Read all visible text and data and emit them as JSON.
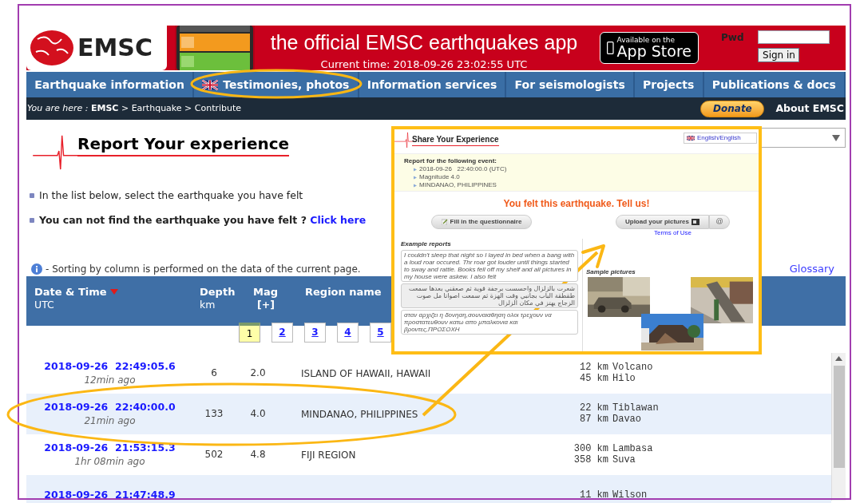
{
  "header": {
    "logo": "EMSC",
    "app_title": "the official EMSC earthquakes app",
    "current_time": "Current time: 2018-09-26 23:02:55 UTC",
    "app_store": {
      "line1": "Available on the",
      "line2": "App Store"
    },
    "login": {
      "pwd_label": "Pwd",
      "sign_in": "Sign in"
    }
  },
  "nav": [
    {
      "label": "Earthquake information",
      "flag": false
    },
    {
      "label": "Testimonies, photos",
      "flag": true
    },
    {
      "label": "Information services",
      "flag": false
    },
    {
      "label": "For seismologists",
      "flag": false
    },
    {
      "label": "Projects",
      "flag": false
    },
    {
      "label": "Publications & docs",
      "flag": false
    }
  ],
  "breadcrumb": {
    "text": "*You are here :* **EMSC** > Earthquake > Contribute",
    "donate": "Donate",
    "about": "About EMSC"
  },
  "page": {
    "title": "Report Your experience",
    "instructions": [
      {
        "text": "In the list below, select the earthquake you have felt",
        "bold": false
      },
      {
        "text": "You can not find the earthquake you have felt ?",
        "bold": true,
        "link": "Click here"
      }
    ],
    "sort_note": "- Sorting by column is performed on the data of the current page.",
    "glossary": "Glossary"
  },
  "table": {
    "columns": [
      {
        "label": "Date & Time",
        "sub": "UTC",
        "sorted": true
      },
      {
        "label": "Depth",
        "sub": "km",
        "sorted": false
      },
      {
        "label": "Mag",
        "sub": "[+]",
        "sorted": false
      },
      {
        "label": "Region name",
        "sorted": false
      }
    ],
    "pages": [
      {
        "label": "1",
        "selected": true
      },
      {
        "label": "2",
        "selected": false
      },
      {
        "label": "3",
        "selected": false
      },
      {
        "label": "4",
        "selected": false
      },
      {
        "label": "5",
        "selected": false
      }
    ],
    "rows": [
      {
        "datetime": "2018-09-26  22:49:05.6",
        "ago": "12min ago",
        "depth": "6",
        "mag": "2.0",
        "region": "ISLAND OF HAWAII, HAWAII",
        "cities": [
          {
            "distance": "12 km",
            "place": "Volcano"
          },
          {
            "distance": "45 km",
            "place": "Hilo"
          }
        ]
      },
      {
        "datetime": "2018-09-26  22:40:00.0",
        "ago": "21min ago",
        "depth": "133",
        "mag": "4.0",
        "region": "MINDANAO, PHILIPPINES",
        "cities": [
          {
            "distance": "22 km",
            "place": "Tiblawan"
          },
          {
            "distance": "87 km",
            "place": "Davao"
          }
        ]
      },
      {
        "datetime": "2018-09-26  21:53:15.3",
        "ago": "1hr 08min ago",
        "depth": "502",
        "mag": "4.8",
        "region": "FIJI REGION",
        "cities": [
          {
            "distance": "300 km",
            "place": "Lambasa"
          },
          {
            "distance": "358 km",
            "place": "Suva"
          }
        ]
      },
      {
        "datetime": "2018-09-26  21:47:48.9",
        "cities": [
          {
            "distance": "11 km",
            "place": "Wilson"
          }
        ]
      }
    ]
  },
  "share_panel": {
    "title": "Share Your Experience",
    "language": "English/English",
    "event_heading": "Report for the following event:",
    "event_details": [
      "2018-09-26   22:40:00.0 (UTC)",
      "Magnitude 4.0",
      "MINDANAO, PHILIPPINES"
    ],
    "call": "You felt this earthquake. Tell us!",
    "questionnaire": "Fill in the questionnaire",
    "upload": "Upload your pictures",
    "email": "@",
    "terms": "Terms of Use",
    "examples_heading": "Example reports",
    "examples": [
      "I couldn't sleep that night so I layed in bed when a bang with a loud roar occured. Thr roar got louder until things started to sway and rattle. Books fell off my shelf and all pictures in my house were askew. I also felt",
      "شعرت بالزلزال واحسست برجفة قوية ثم صعقني بعدها سمعت طقطقة الباب بجانبي وقت الهزة ثم سمعت اصواتا مل صوت الزجاج يهتز في مكان الزلزال",
      "σταν αρχιζει η δονηση,σουναισθηση ολοι τρεχουν να προστατευθουν κατω απο μπαλκονια και βροντες,ΠΡΟΣΟΧΗ"
    ],
    "pictures_heading": "Sample pictures",
    "pictures": [
      {
        "kind": "picture"
      },
      {
        "kind": "picture"
      },
      {
        "kind": "picture"
      }
    ]
  }
}
